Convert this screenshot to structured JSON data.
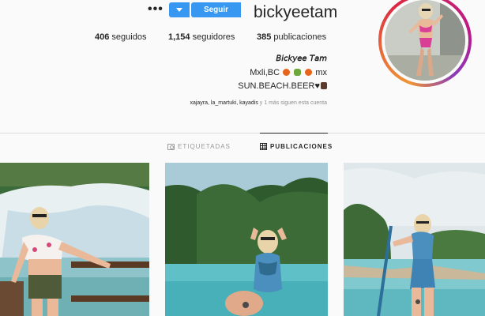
{
  "profile": {
    "username": "bickyeetam",
    "follow_label": "Seguir",
    "more_label": "•••",
    "stats": {
      "posts": "385",
      "posts_label": "publicaciones",
      "followers": "1,154",
      "followers_label": "seguidores",
      "following": "406",
      "following_label": "seguidos"
    },
    "bio": {
      "name": "𝘉𝘪𝘤𝘬𝘺𝘦𝘦 𝘛𝘢𝘮",
      "location_prefix": "Mxli,BC",
      "location_suffix": "mx",
      "line3": "SUN.BEACH.BEER",
      "heart": "♥"
    },
    "followed_by": {
      "names": "xajayra, la_martuki, kayadis",
      "rest": "y 1 más siguen esta cuenta"
    }
  },
  "tabs": {
    "posts": "PUBLICACIONES",
    "tagged": "ETIQUETADAS"
  },
  "colors": {
    "accent": "#3897f0",
    "text": "#262626",
    "muted": "#8e8e8e",
    "background": "#fafafa"
  },
  "icons": {
    "more": "more-options-icon",
    "dropdown": "chevron-down-icon",
    "posts_tab": "grid-icon",
    "tagged_tab": "tag-icon"
  }
}
